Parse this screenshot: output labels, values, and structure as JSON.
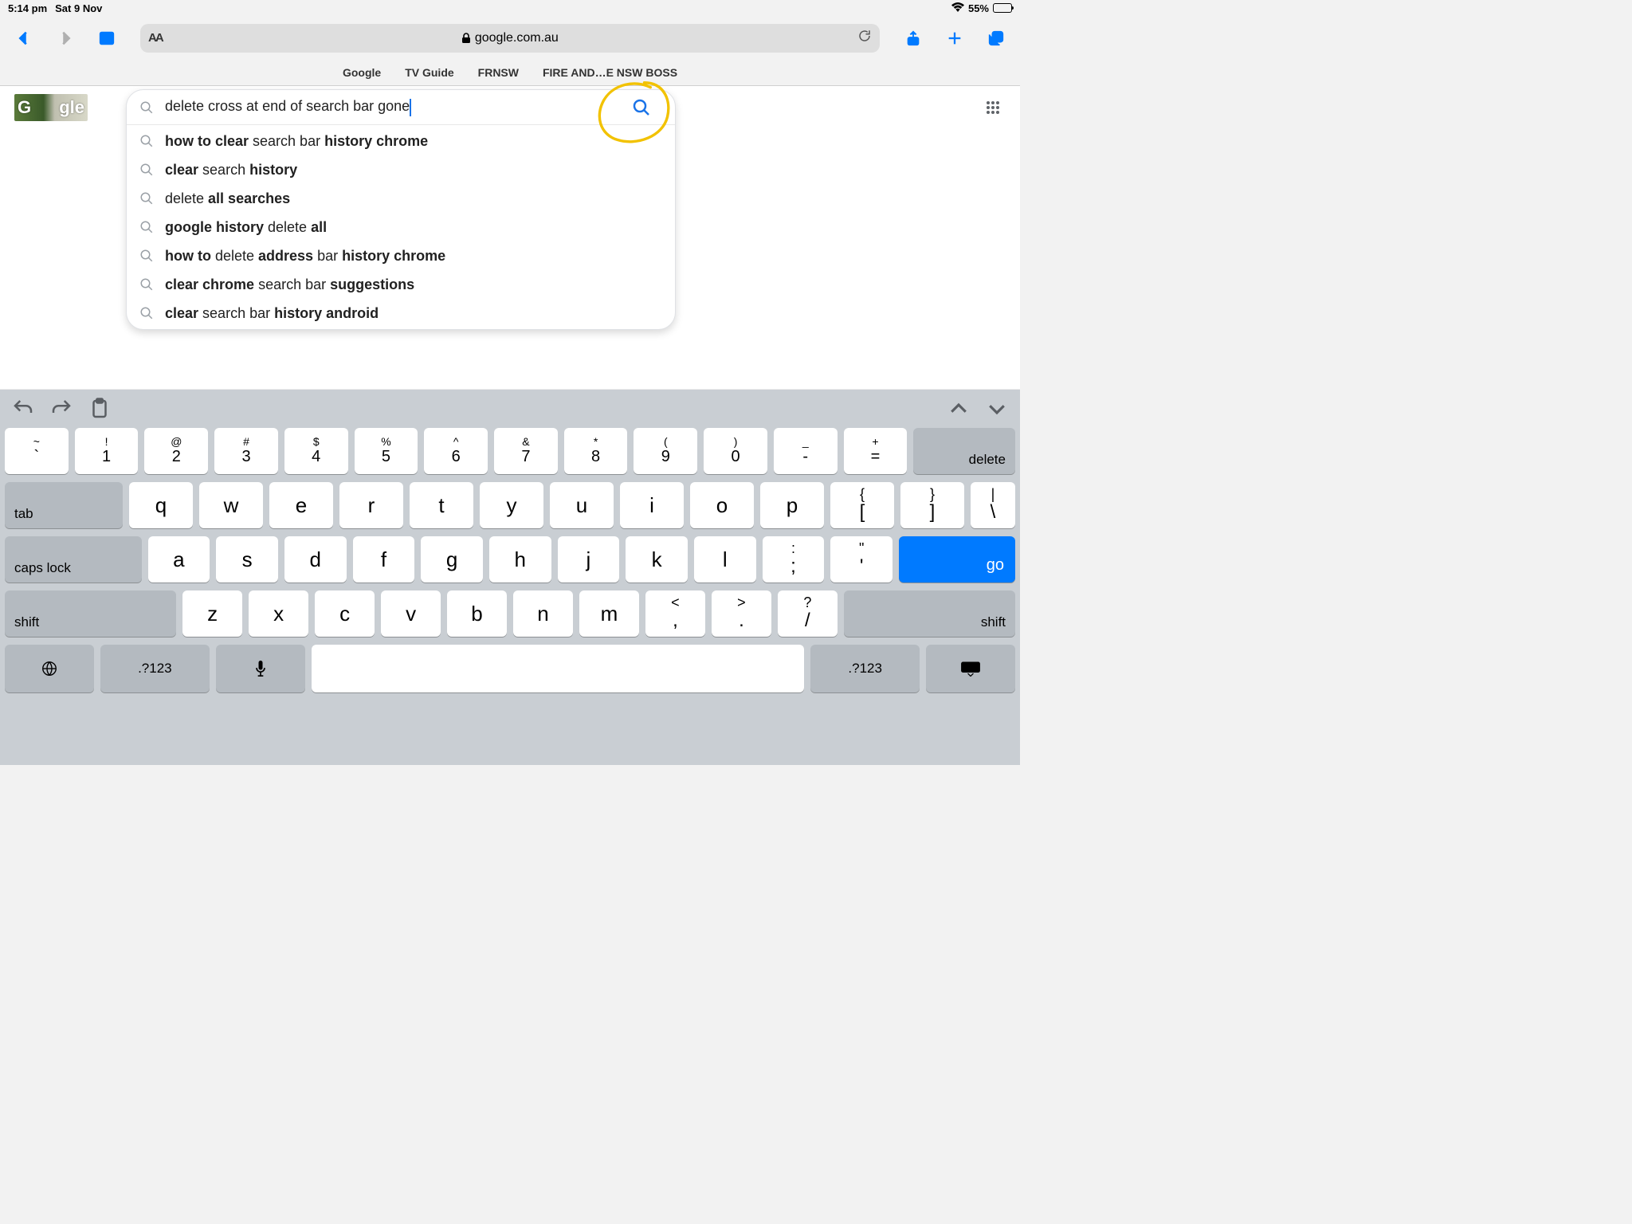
{
  "status": {
    "time": "5:14 pm",
    "date": "Sat 9 Nov",
    "battery": "55%"
  },
  "safari": {
    "aa": "AA",
    "url": "google.com.au",
    "favorites": [
      "Google",
      "TV Guide",
      "FRNSW",
      "FIRE AND…E NSW BOSS"
    ]
  },
  "google": {
    "logo_left": "G",
    "logo_right": "gle",
    "search_query": "delete cross at end of search bar gone",
    "suggestions": [
      [
        [
          "how to clear",
          true
        ],
        [
          " search bar ",
          false
        ],
        [
          "history chrome",
          true
        ]
      ],
      [
        [
          "clear",
          true
        ],
        [
          " search ",
          false
        ],
        [
          "history",
          true
        ]
      ],
      [
        [
          "delete ",
          false
        ],
        [
          "all searches",
          true
        ]
      ],
      [
        [
          "google history",
          true
        ],
        [
          " delete ",
          false
        ],
        [
          "all",
          true
        ]
      ],
      [
        [
          "how to",
          true
        ],
        [
          " delete ",
          false
        ],
        [
          "address",
          true
        ],
        [
          " bar ",
          false
        ],
        [
          "history chrome",
          true
        ]
      ],
      [
        [
          "clear chrome",
          true
        ],
        [
          " search bar ",
          false
        ],
        [
          "suggestions",
          true
        ]
      ],
      [
        [
          "clear",
          true
        ],
        [
          " search bar ",
          false
        ],
        [
          "history android",
          true
        ]
      ]
    ]
  },
  "keyboard": {
    "row1": [
      {
        "sub": "~",
        "main": "`"
      },
      {
        "sub": "!",
        "main": "1"
      },
      {
        "sub": "@",
        "main": "2"
      },
      {
        "sub": "#",
        "main": "3"
      },
      {
        "sub": "$",
        "main": "4"
      },
      {
        "sub": "%",
        "main": "5"
      },
      {
        "sub": "^",
        "main": "6"
      },
      {
        "sub": "&",
        "main": "7"
      },
      {
        "sub": "*",
        "main": "8"
      },
      {
        "sub": "(",
        "main": "9"
      },
      {
        "sub": ")",
        "main": "0"
      },
      {
        "sub": "_",
        "main": "-"
      },
      {
        "sub": "+",
        "main": "="
      }
    ],
    "delete": "delete",
    "tab": "tab",
    "row2": [
      "q",
      "w",
      "e",
      "r",
      "t",
      "y",
      "u",
      "i",
      "o",
      "p"
    ],
    "row2_punct": [
      {
        "sub": "{",
        "main": "["
      },
      {
        "sub": "}",
        "main": "]"
      },
      {
        "sub": "|",
        "main": "\\"
      }
    ],
    "caps": "caps lock",
    "row3": [
      "a",
      "s",
      "d",
      "f",
      "g",
      "h",
      "j",
      "k",
      "l"
    ],
    "row3_punct": [
      {
        "sub": ":",
        "main": ";"
      },
      {
        "sub": "\"",
        "main": "'"
      }
    ],
    "go": "go",
    "shift": "shift",
    "row4": [
      "z",
      "x",
      "c",
      "v",
      "b",
      "n",
      "m"
    ],
    "row4_punct": [
      {
        "sub": "<",
        "main": ","
      },
      {
        "sub": ">",
        "main": "."
      },
      {
        "sub": "?",
        "main": "/"
      }
    ],
    "numkey": ".?123"
  }
}
